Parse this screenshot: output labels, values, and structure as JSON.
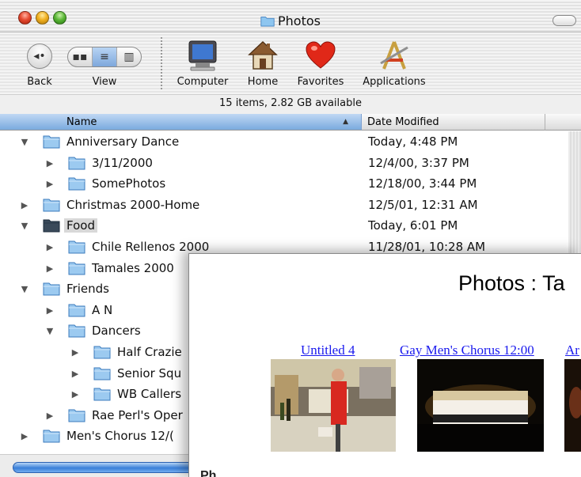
{
  "window": {
    "title": "Photos"
  },
  "toolbar": {
    "back_label": "Back",
    "view_label": "View",
    "computer_label": "Computer",
    "home_label": "Home",
    "favorites_label": "Favorites",
    "applications_label": "Applications",
    "view_modes": [
      "icon-view",
      "list-view",
      "column-view"
    ],
    "view_selected": "list-view"
  },
  "status": {
    "text": "15 items, 2.82 GB available"
  },
  "columns": {
    "name": "Name",
    "date": "Date Modified",
    "sort_indicator": "▲"
  },
  "rows": [
    {
      "name": "Anniversary Dance",
      "date": "Today, 4:48 PM",
      "expanded": true,
      "depth": 0
    },
    {
      "name": "3/11/2000",
      "date": "12/4/00, 3:37 PM",
      "expanded": false,
      "depth": 1
    },
    {
      "name": "SomePhotos",
      "date": "12/18/00, 3:44 PM",
      "expanded": false,
      "depth": 1
    },
    {
      "name": "Christmas 2000-Home",
      "date": "12/5/01, 12:31 AM",
      "expanded": false,
      "depth": 0
    },
    {
      "name": "Food",
      "date": "Today, 6:01 PM",
      "expanded": true,
      "depth": 0,
      "selected": true
    },
    {
      "name": "Chile Rellenos 2000",
      "date": "11/28/01, 10:28 AM",
      "expanded": false,
      "depth": 1
    },
    {
      "name": "Tamales 2000",
      "date": "",
      "expanded": false,
      "depth": 1
    },
    {
      "name": "Friends",
      "date": "",
      "expanded": true,
      "depth": 0
    },
    {
      "name": "A N",
      "date": "",
      "expanded": false,
      "depth": 1
    },
    {
      "name": "Dancers",
      "date": "",
      "expanded": true,
      "depth": 1
    },
    {
      "name": "Half Crazie",
      "date": "",
      "expanded": false,
      "depth": 2
    },
    {
      "name": "Senior Squ",
      "date": "",
      "expanded": false,
      "depth": 2
    },
    {
      "name": "WB Callers",
      "date": "",
      "expanded": false,
      "depth": 2
    },
    {
      "name": "Rae Perl's Oper",
      "date": "",
      "expanded": false,
      "depth": 1
    },
    {
      "name": "Men's Chorus 12/(",
      "date": "",
      "expanded": false,
      "depth": 0
    }
  ],
  "overlay": {
    "title": "Photos : Ta",
    "thumbnails": [
      {
        "label": "Untitled 4"
      },
      {
        "label": "Gay Men's Chorus 12:00"
      },
      {
        "label": "Ar"
      }
    ],
    "bottom_text": "Ph..."
  },
  "colors": {
    "selection_header": "#7aaade",
    "link": "#1a1aee",
    "folder": "#8ec6f0"
  }
}
